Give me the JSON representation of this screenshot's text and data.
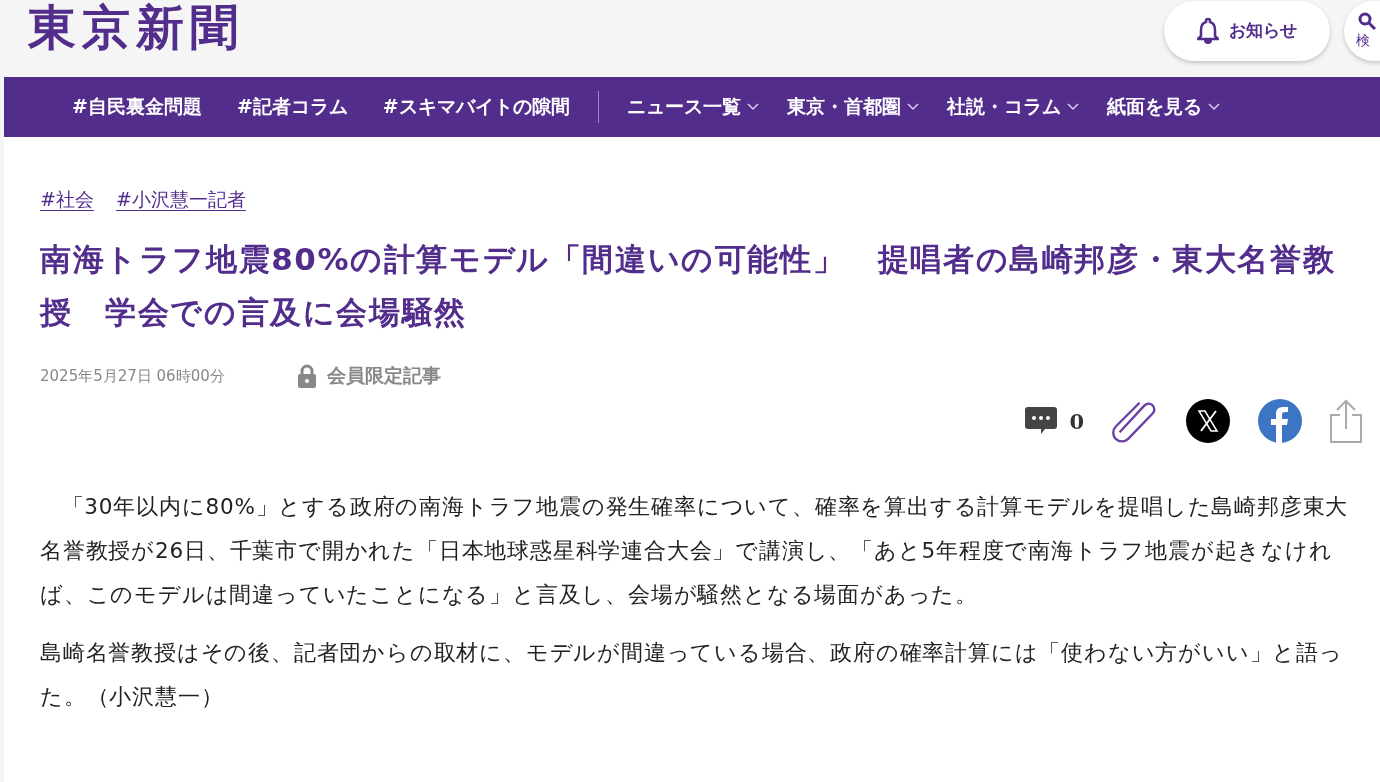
{
  "header": {
    "logo": "東京新聞",
    "notice_button": "お知らせ",
    "search_button": "検"
  },
  "nav": {
    "tags": [
      "#自民裏金問題",
      "#記者コラム",
      "#スキマバイトの隙間"
    ],
    "menus": [
      "ニュース一覧",
      "東京・首都圏",
      "社説・コラム",
      "紙面を見る"
    ]
  },
  "article": {
    "tags": [
      "#社会",
      "#小沢慧一記者"
    ],
    "title": "南海トラフ地震80%の計算モデル「間違いの可能性」　提唱者の島崎邦彦・東大名誉教授　学会での言及に会場騒然",
    "date": "2025年5月27日 06時00分",
    "member_label": "会員限定記事",
    "comment_count": "0",
    "paragraphs": [
      "「30年以内に80%」とする政府の南海トラフ地震の発生確率について、確率を算出する計算モデルを提唱した島崎邦彦東大名誉教授が26日、千葉市で開かれた「日本地球惑星科学連合大会」で講演し、「あと5年程度で南海トラフ地震が起きなければ、このモデルは間違っていたことになる」と言及し、会場が騒然となる場面があった。",
      "島崎名誉教授はその後、記者団からの取材に、モデルが間違っている場合、政府の確率計算には「使わない方がいい」と語った。（小沢慧一）"
    ]
  }
}
